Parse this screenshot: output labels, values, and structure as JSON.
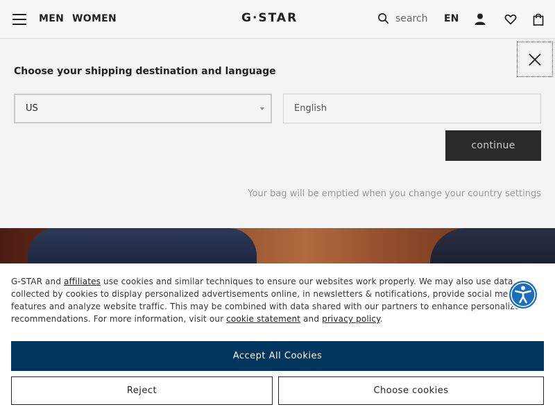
{
  "header": {
    "nav": [
      "MEN",
      "WOMEN"
    ],
    "logo": "G·STAR",
    "search_label": "search",
    "language": "EN"
  },
  "country_selector": {
    "title": "Choose your shipping destination and language",
    "country_value": "US",
    "language_value": "English",
    "continue_label": "continue",
    "note": "Your bag will be emptied when you change your country settings"
  },
  "cookie_banner": {
    "text_1": "G-STAR and ",
    "link_affiliates": "affiliates",
    "text_2": " use cookies and similar techniques to ensure our websites work properly. We may also use data collected by cookies to display personalized advertisements online, in newsletters & notifications, provide social media features and analyze website traffic. This may be combined with data shared with our partners to enhance personalized recommendations. For more information, visit our ",
    "link_cookie": "cookie statement",
    "text_3": " and ",
    "link_privacy": "privacy policy",
    "text_4": ".",
    "accept_label": "Accept All Cookies",
    "reject_label": "Reject",
    "choose_label": "Choose cookies"
  },
  "colors": {
    "accept_button": "#00355d",
    "accessibility_icon": "#1a6fbd",
    "continue_button": "#2a2a2a"
  },
  "icons": [
    "menu-icon",
    "search-icon",
    "user-icon",
    "heart-icon",
    "bag-icon",
    "close-icon",
    "accessibility-icon",
    "caret-down-icon"
  ]
}
